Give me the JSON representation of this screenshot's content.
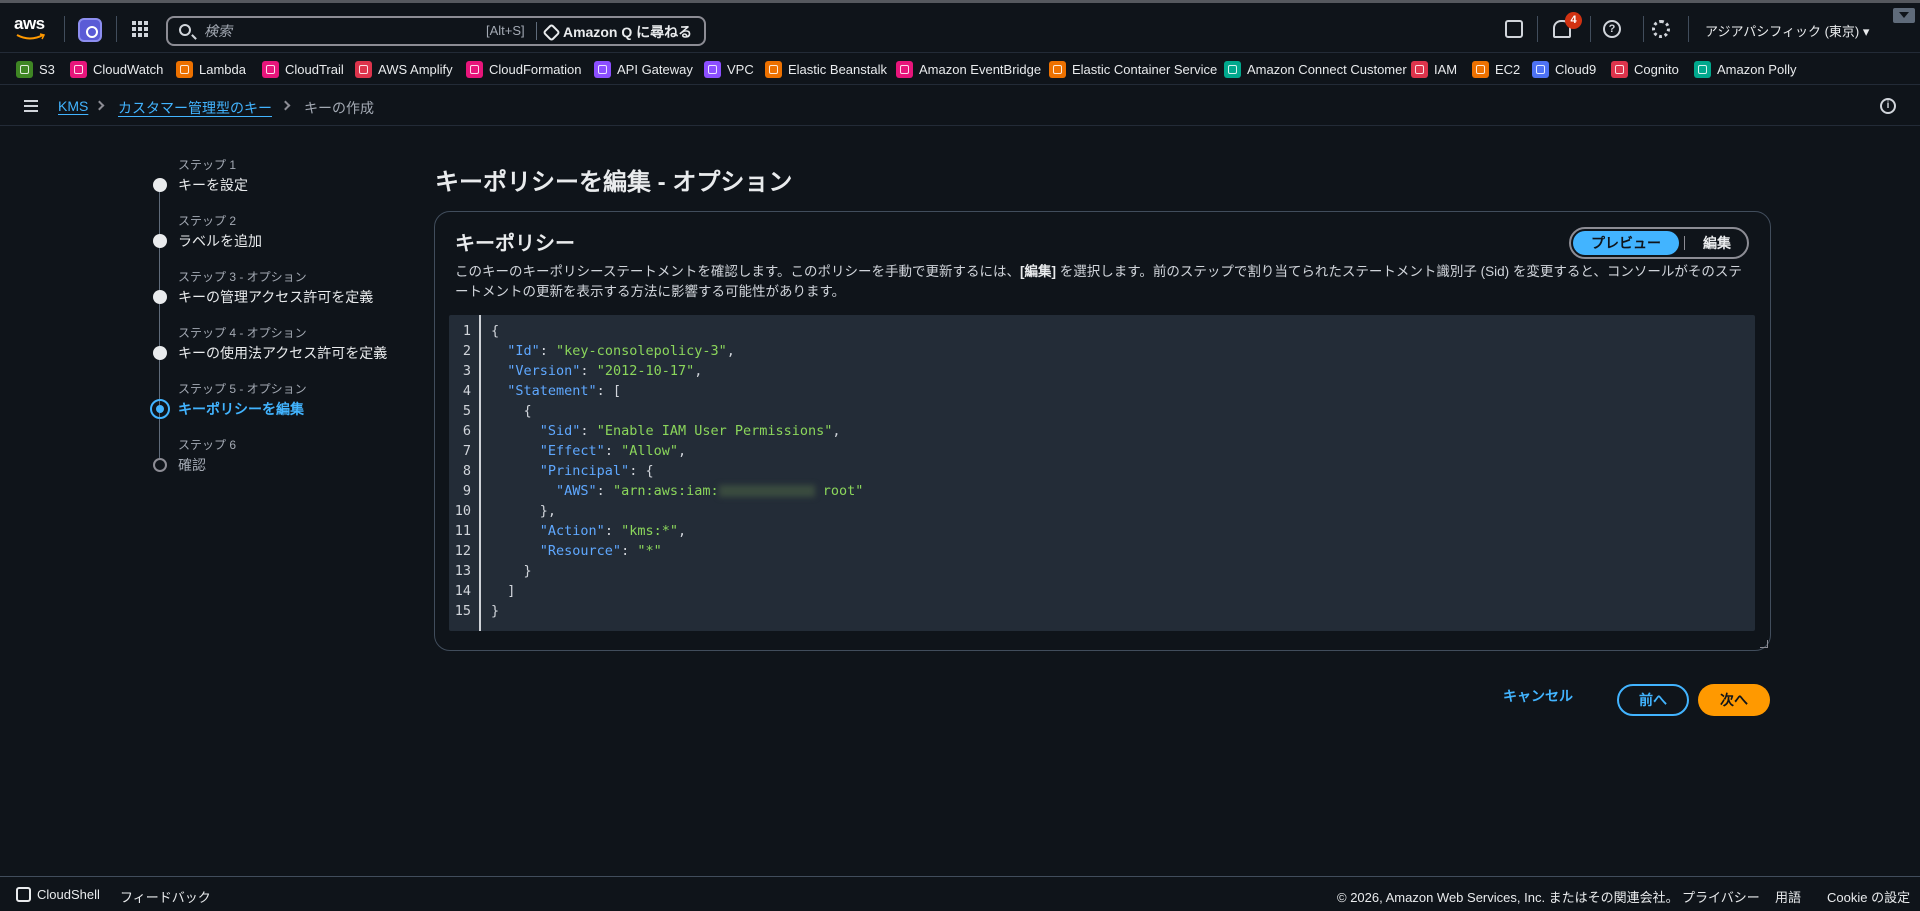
{
  "topbar": {
    "logo_text": "aws",
    "search_placeholder": "検索",
    "search_shortcut": "[Alt+S]",
    "amazon_q_label": "Amazon Q に尋ねる",
    "notification_count": "4",
    "region": "アジアパシフィック (東京) ▾",
    "help_glyph": "?"
  },
  "favorites": [
    {
      "label": "S3",
      "color": "#3f8624"
    },
    {
      "label": "CloudWatch",
      "color": "#e7157b"
    },
    {
      "label": "Lambda",
      "color": "#ed7100"
    },
    {
      "label": "CloudTrail",
      "color": "#e7157b"
    },
    {
      "label": "AWS Amplify",
      "color": "#dd344c"
    },
    {
      "label": "CloudFormation",
      "color": "#e7157b"
    },
    {
      "label": "API Gateway",
      "color": "#8c4fff"
    },
    {
      "label": "VPC",
      "color": "#8c4fff"
    },
    {
      "label": "Elastic Beanstalk",
      "color": "#ed7100"
    },
    {
      "label": "Amazon EventBridge",
      "color": "#e7157b"
    },
    {
      "label": "Elastic Container Service",
      "color": "#ed7100"
    },
    {
      "label": "Amazon Connect Customer",
      "color": "#01a88d"
    },
    {
      "label": "IAM",
      "color": "#dd344c"
    },
    {
      "label": "EC2",
      "color": "#ed7100"
    },
    {
      "label": "Cloud9",
      "color": "#4d72f3"
    },
    {
      "label": "Cognito",
      "color": "#dd344c"
    },
    {
      "label": "Amazon Polly",
      "color": "#01a88d"
    }
  ],
  "breadcrumb": {
    "items": [
      "KMS",
      "カスタマー管理型のキー",
      "キーの作成"
    ],
    "info_glyph": "i"
  },
  "steps": [
    {
      "label": "ステップ 1",
      "name": "キーを設定"
    },
    {
      "label": "ステップ 2",
      "name": "ラベルを追加"
    },
    {
      "label": "ステップ 3 - オプション",
      "name": "キーの管理アクセス許可を定義"
    },
    {
      "label": "ステップ 4 - オプション",
      "name": "キーの使用法アクセス許可を定義"
    },
    {
      "label": "ステップ 5 - オプション",
      "name": "キーポリシーを編集"
    },
    {
      "label": "ステップ 6",
      "name": "確認"
    }
  ],
  "page": {
    "title": "キーポリシーを編集 - オプション"
  },
  "panel": {
    "title": "キーポリシー",
    "desc_1": "このキーのキーポリシーステートメントを確認します。このポリシーを手動で更新するには、",
    "desc_bold": "[編集]",
    "desc_2": " を選択します。前のステップで割り当てられたステートメント識別子 (Sid) を変更すると、コンソールがそのステートメントの更新を表示する方法に影響する可能性があります。",
    "tab_preview": "プレビュー",
    "tab_edit": "編集"
  },
  "code": {
    "line_numbers": [
      "1",
      "2",
      "3",
      "4",
      "5",
      "6",
      "7",
      "8",
      "9",
      "10",
      "11",
      "12",
      "13",
      "14",
      "15"
    ],
    "p1": "{",
    "k_id": "\"Id\"",
    "v_id": "\"key-consolepolicy-3\"",
    "k_version": "\"Version\"",
    "v_version": "\"2012-10-17\"",
    "k_statement": "\"Statement\"",
    "p5": "{",
    "k_sid": "\"Sid\"",
    "v_sid": "\"Enable IAM User Permissions\"",
    "k_effect": "\"Effect\"",
    "v_effect": "\"Allow\"",
    "k_principal": "\"Principal\"",
    "k_aws": "\"AWS\"",
    "v_aws_prefix": "\"arn:aws:iam:",
    "v_aws_suffix": " root\"",
    "p10": "},",
    "k_action": "\"Action\"",
    "v_action": "\"kms:*\"",
    "k_resource": "\"Resource\"",
    "v_resource": "\"*\"",
    "p13": "}",
    "p14": "]",
    "p15": "}"
  },
  "actions": {
    "cancel": "キャンセル",
    "prev": "前へ",
    "next": "次へ"
  },
  "footer": {
    "cloudshell": "CloudShell",
    "feedback": "フィードバック",
    "copyright": "© 2026, Amazon Web Services, Inc. またはその関連会社。",
    "privacy": "プライバシー",
    "terms": "用語",
    "cookie": "Cookie の設定"
  }
}
